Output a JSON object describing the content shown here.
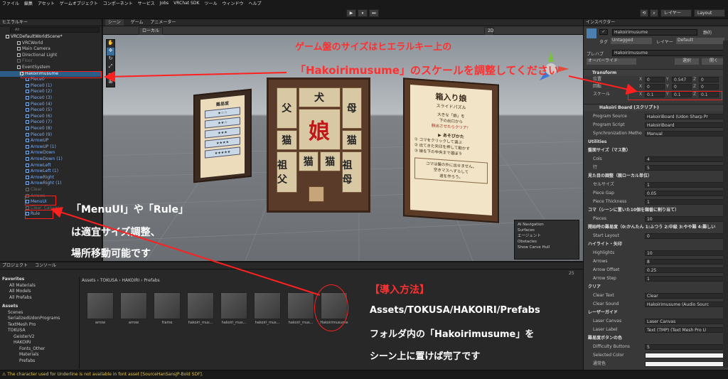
{
  "menubar": [
    "ファイル",
    "編集",
    "アセット",
    "ゲームオブジェクト",
    "コンポーネント",
    "サービス",
    "Jobs",
    "VRChat SDK",
    "ツール",
    "ウィンドウ",
    "ヘルプ"
  ],
  "toolbar": {
    "layers": "レイヤー",
    "layout": "Layout",
    "play": "▶",
    "pause": "⏸",
    "step": "⏭"
  },
  "hierarchy": {
    "title": "ヒエラルキー",
    "search": "All",
    "scene": "VRCDefaultWorldScene*",
    "items": [
      {
        "label": "VRCWorld",
        "t": "n"
      },
      {
        "label": "Main Camera",
        "t": "n"
      },
      {
        "label": "Directional Light",
        "t": "n"
      },
      {
        "label": "Floor",
        "t": "d"
      },
      {
        "label": "EventSystem",
        "t": "n"
      },
      {
        "label": "Hakoirimusume",
        "t": "s"
      },
      {
        "label": "Piece0",
        "t": "p"
      },
      {
        "label": "Piece0 (1)",
        "t": "p"
      },
      {
        "label": "Piece0 (2)",
        "t": "p"
      },
      {
        "label": "Piece0 (3)",
        "t": "p"
      },
      {
        "label": "Piece0 (4)",
        "t": "p"
      },
      {
        "label": "Piece0 (5)",
        "t": "p"
      },
      {
        "label": "Piece0 (6)",
        "t": "p"
      },
      {
        "label": "Piece0 (7)",
        "t": "p"
      },
      {
        "label": "Piece0 (8)",
        "t": "p"
      },
      {
        "label": "Piece0 (9)",
        "t": "p"
      },
      {
        "label": "ArrowUP",
        "t": "p"
      },
      {
        "label": "ArrowUP (1)",
        "t": "p"
      },
      {
        "label": "ArrowDown",
        "t": "p"
      },
      {
        "label": "ArrowDown (1)",
        "t": "p"
      },
      {
        "label": "ArrowLeft",
        "t": "p"
      },
      {
        "label": "ArrowLeft (1)",
        "t": "p"
      },
      {
        "label": "ArrowRight",
        "t": "p"
      },
      {
        "label": "ArrowRight (1)",
        "t": "p"
      },
      {
        "label": "Clear",
        "t": "d"
      },
      {
        "label": "Arrows",
        "t": "d"
      },
      {
        "label": "MenuUI",
        "t": "p"
      },
      {
        "label": "Clear_Canvas",
        "t": "d"
      },
      {
        "label": "Rule",
        "t": "p"
      }
    ]
  },
  "scene": {
    "tab1": "シーン",
    "tab2": "ゲーム",
    "tab3": "アニメーター",
    "shading": "ローカル",
    "mode2d": "2D"
  },
  "scene_board": {
    "title": "箱入り娘",
    "subtitle": "スライドパズル",
    "desc": [
      "大きな「娘」を",
      "下の出口から",
      "脱出させたらクリア！"
    ],
    "howto": "あそびかた",
    "steps": [
      "① コマをクリックして選ぶ",
      "② 出てきた矢印を押して動かす",
      "③ 娘を下の中央まで運ぼう"
    ],
    "note": [
      "コマは盤の外に出せません。",
      "空きマスへずらして",
      "道を作ろう。"
    ],
    "diff_title": "難易度",
    "diff_rows": [
      "★☆☆",
      "★★☆",
      "★★★",
      "★★★★",
      "★★★★★"
    ],
    "pieces": [
      "父",
      "犬",
      "母",
      "猫",
      "娘",
      "猫",
      "祖父",
      "猫",
      "猫",
      "祖母"
    ]
  },
  "navigation": {
    "title": "AI Navigation",
    "items": [
      "Surfaces",
      "エージェント",
      "Obstacles",
      "Show Carve Hull"
    ]
  },
  "project": {
    "tab1": "プロジェクト",
    "tab2": "コンソール",
    "breadcrumb": [
      "Assets",
      "TOKUSA",
      "HAKOIRI",
      "Prefabs"
    ],
    "favorites": "Favorites",
    "fav_items": [
      "All Materials",
      "All Models",
      "All Prefabs"
    ],
    "assets_root": "Assets",
    "tree": [
      "Scenes",
      "SerializedUdonPrograms",
      "TextMesh Pro",
      "TOKUSA",
      "GeisterV2",
      "HAKOIRI",
      "Fonts_Other",
      "Materials",
      "Prefabs"
    ],
    "assets": [
      "arrow",
      "arrow",
      "frame",
      "hakoiri_mus...",
      "hakoiri_mus...",
      "hakoiri_mus...",
      "hakoiri_mus...",
      "Hakoirimusume"
    ],
    "count": "25"
  },
  "inspector": {
    "title": "インスペクター",
    "object": "Hakoirimusume",
    "static": "静的",
    "tag_label": "タグ",
    "tag": "Untagged",
    "layer_label": "レイヤー",
    "layer": "Default",
    "override": "オーバーライド",
    "select": "選択",
    "open": "開く",
    "prefab_label": "プレハブ",
    "prefab": "Hakoirimusume",
    "transform": "Transform",
    "pos_label": "位置",
    "pos": {
      "x": "0",
      "y": "0.547",
      "z": "0"
    },
    "rot_label": "回転",
    "rot": {
      "x": "0",
      "y": "0",
      "z": "0"
    },
    "scale_label": "スケール",
    "scale": {
      "x": "0.1",
      "y": "0.1",
      "z": "0.1"
    },
    "script_header": "Hakoiri Board (スクリプト)",
    "rows": [
      {
        "l": "Program Source",
        "v": "HakoiriBoard (Udon Sharp Pr",
        "t": "r"
      },
      {
        "l": "Program Script",
        "v": "HakoiriBoard",
        "t": "r"
      },
      {
        "l": "Synchronization Metho",
        "v": "Manual",
        "t": "r"
      },
      {
        "l": "Utilities",
        "t": "s"
      },
      {
        "l": "盤面サイズ（マス数）",
        "t": "s"
      },
      {
        "l": "Cols",
        "v": "4",
        "t": "r"
      },
      {
        "l": "行",
        "v": "5",
        "t": "r"
      },
      {
        "l": "見た目の調整（親ローカル単位）",
        "t": "s"
      },
      {
        "l": "セルサイズ",
        "v": "1",
        "t": "r"
      },
      {
        "l": "Piece Gap",
        "v": "0.05",
        "t": "r"
      },
      {
        "l": "Piece Thickness",
        "v": "1",
        "t": "r"
      },
      {
        "l": "コマ（シーンに置いた10個を順番に割り当て）",
        "t": "s"
      },
      {
        "l": "Pieces",
        "v": "10",
        "t": "r"
      },
      {
        "l": "開始時の難易度（0:かんたん 1:ふつう 2:中級 3:やや難 4:難しい",
        "t": "s"
      },
      {
        "l": "Start Layout",
        "v": "0",
        "t": "r"
      },
      {
        "l": "ハイライト・矢印",
        "t": "s"
      },
      {
        "l": "Highlights",
        "v": "10",
        "t": "r"
      },
      {
        "l": "Arrows",
        "v": "8",
        "t": "r"
      },
      {
        "l": "Arrow Offset",
        "v": "0.25",
        "t": "r"
      },
      {
        "l": "Arrow Step",
        "v": "1",
        "t": "r"
      },
      {
        "l": "クリア",
        "t": "s"
      },
      {
        "l": "Clear Text",
        "v": "Clear",
        "t": "r"
      },
      {
        "l": "Clear Sound",
        "v": "Hakoirimusume (Audio Sourc",
        "t": "r"
      },
      {
        "l": "レーザーガイド",
        "t": "s"
      },
      {
        "l": "Laser Canvas",
        "v": "Laser Canvas",
        "t": "r"
      },
      {
        "l": "Laser Label",
        "v": "Text (TMP) (Text Mesh Pro U",
        "t": "r"
      },
      {
        "l": "難易度ボタンの色",
        "t": "s"
      },
      {
        "l": "Difficulty Buttons",
        "v": "5",
        "t": "r"
      },
      {
        "l": "Selected Color",
        "v": "",
        "t": "r"
      },
      {
        "l": "通常色",
        "v": "",
        "t": "r"
      }
    ]
  },
  "annotations": {
    "top1": "ゲーム盤のサイズはヒエラルキー上の",
    "top2": "「Hakoirimusume」のスケールを調整してください",
    "mid1": "「MenuUI」や「Rule」",
    "mid2": "は適宜サイズ調整、",
    "mid3": "場所移動可能です",
    "bot1": "【導入方法】",
    "bot2": "Assets/TOKUSA/HAKOIRI/Prefabs",
    "bot3": "フォルダ内の「Hakoirimusume」を",
    "bot4": "シーン上に置けば完了です"
  },
  "status": "The character used for Underline is not available in font asset [SourceHanSansJP-Bold SDF].",
  "colors": {
    "annot_red": "#ff2020",
    "selected": "#2c5d87",
    "prefab_text": "#7cacf0",
    "warn": "#e2c24a"
  }
}
